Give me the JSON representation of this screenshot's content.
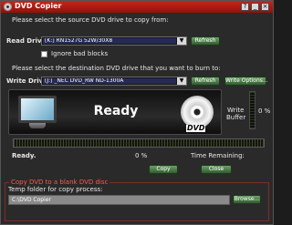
{
  "window": {
    "title": "DVD Copier",
    "controls": [
      "?",
      "_",
      "×"
    ]
  },
  "source": {
    "prompt": "Please select the source DVD drive to copy from:",
    "label": "Read Drive:",
    "value": "[K:] RN1527G  52W/30X8",
    "refresh": "Refresh",
    "ignore_bad_blocks": "Ignore bad blocks",
    "ignore_bad_blocks_checked": false
  },
  "destination": {
    "prompt": "Please select the destination DVD drive that you want to burn to:",
    "label": "Write Drive:",
    "value": "[J:]  _NEC     DVD_RW ND-1300A",
    "refresh": "Refresh",
    "write_options": "Write Options..."
  },
  "status_panel": {
    "status": "Ready",
    "logo": "DVD"
  },
  "write_buffer": {
    "label_line1": "Write",
    "label_line2": "Buffer",
    "percent": "0 %",
    "level": 0
  },
  "progress": {
    "status": "Ready.",
    "percent": "0 %",
    "time_remaining_label": "Time Remaining:",
    "fraction": 0
  },
  "actions": {
    "copy": "Copy",
    "close": "Close"
  },
  "temp": {
    "group_title": "Copy DVD to a blank DVD disc",
    "label": "Temp folder for copy process:",
    "value": "C:\\DVD Copier",
    "browse": "Browse..."
  },
  "colors": {
    "titlebar": "#b51e16",
    "button": "#4f8a4a",
    "progress": "#8fc03a",
    "accent": "#ff5a4a"
  }
}
